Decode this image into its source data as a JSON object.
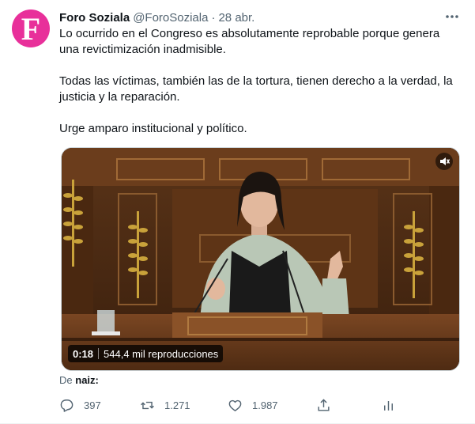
{
  "tweet": {
    "avatar_letter": "F",
    "display_name": "Foro Soziala",
    "handle": "@ForoSoziala",
    "separator": "·",
    "date": "28 abr.",
    "text": [
      "Lo ocurrido en el Congreso es absolutamente reprobable porque genera una revictimización inadmisible.",
      "Todas las víctimas, también las de la tortura, tienen derecho a la verdad, la justicia y la reparación.",
      "Urge amparo institucional y político."
    ],
    "media": {
      "time": "0:18",
      "views": "544,4 mil reproducciones"
    },
    "source": {
      "prefix": "De",
      "user": "naiz:"
    },
    "actions": {
      "replies": "397",
      "retweets": "1.271",
      "likes": "1.987"
    }
  },
  "colors": {
    "avatar_bg": "#e8309a",
    "text": "#0f1419",
    "secondary": "#536471"
  },
  "icons": [
    "more-icon",
    "reply-icon",
    "retweet-icon",
    "like-icon",
    "share-icon",
    "analytics-icon",
    "sound-icon"
  ]
}
